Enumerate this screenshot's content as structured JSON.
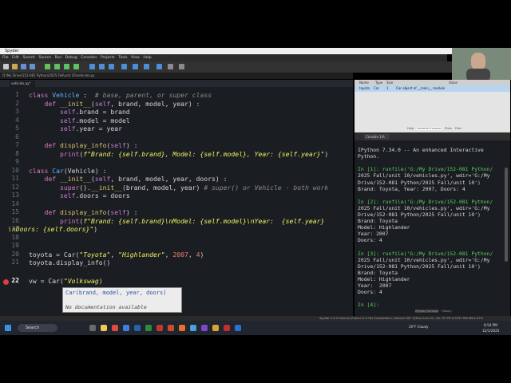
{
  "window": {
    "title": "Spyder",
    "path_label": "D:\\My Drive\\152-081 Python\\2025 Fall\\unit 10\\vehicles.py",
    "path_field": "G:\\My Drive\\152-081 Python\\2025 Fall\\unit 10"
  },
  "menu": [
    "File",
    "Edit",
    "Search",
    "Source",
    "Run",
    "Debug",
    "Consoles",
    "Projects",
    "Tools",
    "View",
    "Help"
  ],
  "editor": {
    "tab_label": "vehicles.py*",
    "line_numbers": [
      "1",
      "2",
      "3",
      "4",
      "5",
      "6",
      "7",
      "8",
      "9",
      "10",
      "11",
      "12",
      "13",
      "14",
      "15",
      "16",
      "17",
      "18",
      "19",
      "20",
      "21",
      "22"
    ],
    "completion": {
      "signature": "Car(brand, model, year, doors)",
      "doc": "No documentation available"
    }
  },
  "variables": {
    "headers": [
      "Name",
      "Type",
      "Size",
      "Value"
    ],
    "row": {
      "name": "toyota",
      "type": "Car",
      "size": "1",
      "value": "Car object of __main__ module"
    },
    "footer_tabs": [
      "Help",
      "Variable Explorer",
      "Plots",
      "Files"
    ]
  },
  "console": {
    "tab_label": "Console 1/A",
    "lines": [
      "IPython 7.34.0 -- An enhanced Interactive",
      "Python.",
      "",
      "In [1]: runfile('G:/My Drive/152-081 Python/",
      "2025 Fall/unit 10/vehicles.py', wdir='G:/My",
      "Drive/152-081 Python/2025 Fall/unit 10')",
      "Brand: Toyota, Year: 2007, Doors: 4",
      "",
      "In [2]: runfile('G:/My Drive/152-081 Python/",
      "2025 Fall/unit 10/vehicles.py', wdir='G:/My",
      "Drive/152-081 Python/2025 Fall/unit 10')",
      "Brand: Toyota",
      "Model: Highlander",
      "Year: 2007",
      "Doors: 4",
      "",
      "In [3]: runfile('G:/My Drive/152-081 Python/",
      "2025 Fall/unit 10/vehicles.py', wdir='G:/My",
      "Drive/152-081 Python/2025 Fall/unit 10')",
      "Brand: Toyota",
      "Model: Highlander",
      "Year:  2007",
      "Doors: 4",
      "",
      "In [4]:"
    ],
    "footer_tabs": [
      "IPython Console",
      "History"
    ]
  },
  "status": {
    "text": "Spyder 5.4.0    internal (Python 3.9.16)    Completions: internal    LSP: Python    Line 22, Col 19    UTF-8    CRLF    RW    Mem 47%"
  },
  "taskbar": {
    "search_label": "Search",
    "weather": "29°F Cloudy",
    "time": "8:54 PM",
    "date": "12/1/2025"
  },
  "colors": {
    "editor_bg": "#1a1d21",
    "keyword": "#d47ac6",
    "class_name": "#5fb2ff",
    "string": "#f0f060",
    "number": "#f47d6d",
    "error_marker": "#e03c3c"
  }
}
